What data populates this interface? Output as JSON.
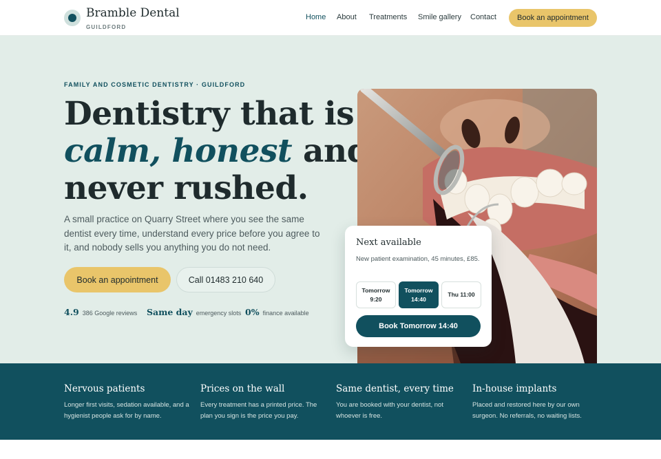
{
  "brand": {
    "name": "Bramble Dental",
    "location": "GUILDFORD"
  },
  "nav": {
    "items": [
      {
        "label": "Home"
      },
      {
        "label": "About"
      },
      {
        "label": "Treatments"
      },
      {
        "label": "Smile gallery"
      },
      {
        "label": "Contact"
      }
    ],
    "active": "Home",
    "cta": "Book an appointment"
  },
  "hero": {
    "eyebrow": "FAMILY AND COSMETIC DENTISTRY · GUILDFORD",
    "headline": {
      "line1": "Dentistry that is",
      "emphasis": "calm, honest",
      "line2_rest": " and",
      "line3": "never rushed."
    },
    "lead": "A small practice on Quarry Street where you see the same dentist every time, understand every price before you agree to it, and nobody sells you anything you do not need.",
    "primary_cta": "Book an appointment",
    "secondary_cta": "Call 01483 210 640",
    "stats": [
      {
        "value": "4.9",
        "label": "386 Google reviews"
      },
      {
        "value": "Same day",
        "label": "emergency slots"
      },
      {
        "value": "0%",
        "label": "finance available"
      }
    ]
  },
  "booking": {
    "title": "Next available",
    "description": "New patient examination, 45 minutes, £85.",
    "slots": [
      {
        "day": "Tomorrow",
        "time": "9:20",
        "selected": false
      },
      {
        "day": "Tomorrow",
        "time": "14:40",
        "selected": true
      },
      {
        "day": "Thu",
        "time": "11:00",
        "selected": false
      }
    ],
    "cta": "Book Tomorrow 14:40"
  },
  "features": [
    {
      "title": "Nervous patients",
      "text": "Longer first visits, sedation available, and a hygienist people ask for by name."
    },
    {
      "title": "Prices on the wall",
      "text": "Every treatment has a printed price. The plan you sign is the price you pay."
    },
    {
      "title": "Same dentist, every time",
      "text": "You are booked with your dentist, not whoever is free."
    },
    {
      "title": "In-house implants",
      "text": "Placed and restored here by our own surgeon. No referrals, no waiting lists."
    }
  ],
  "colors": {
    "brand": "#11505e",
    "accent": "#e9c56a",
    "hero_bg": "#e2ede8"
  }
}
